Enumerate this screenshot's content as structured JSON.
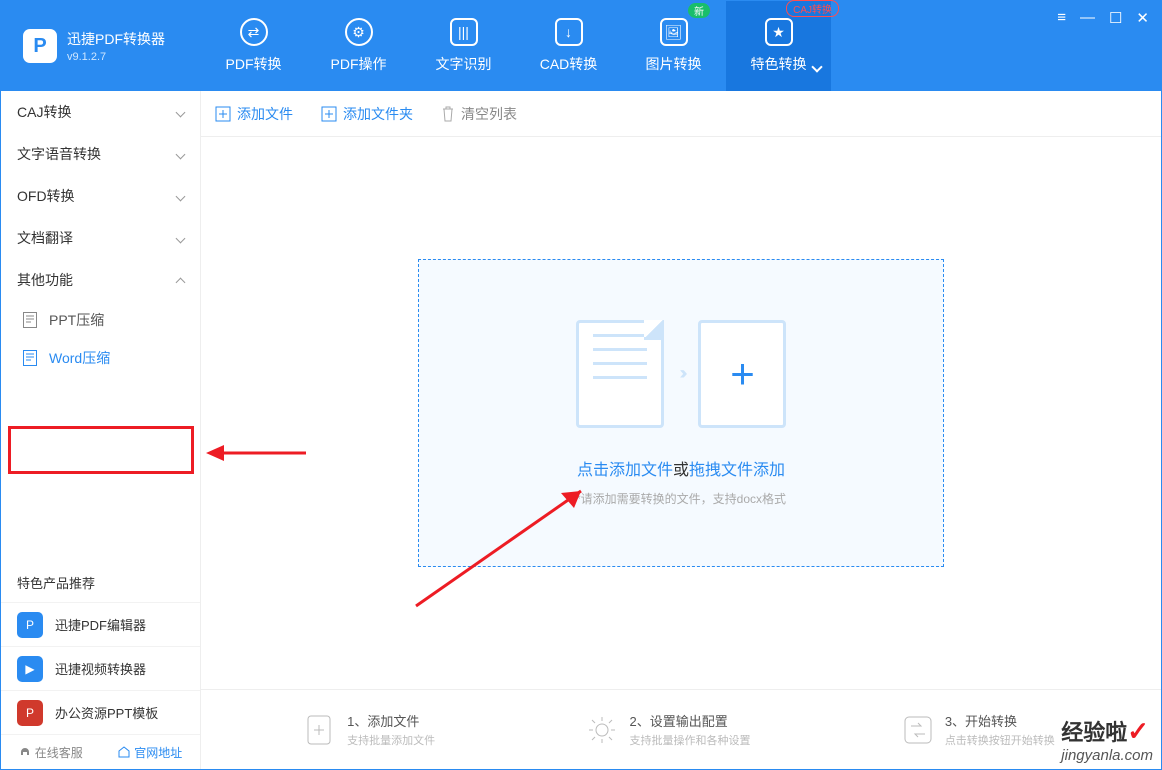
{
  "app": {
    "name": "迅捷PDF转换器",
    "version": "v9.1.2.7"
  },
  "nav": [
    {
      "label": "PDF转换"
    },
    {
      "label": "PDF操作"
    },
    {
      "label": "文字识别"
    },
    {
      "label": "CAD转换"
    },
    {
      "label": "图片转换",
      "badge": "新"
    },
    {
      "label": "特色转换",
      "badge": "CAJ转换"
    }
  ],
  "sidebar": {
    "cats": [
      {
        "label": "CAJ转换"
      },
      {
        "label": "文字语音转换"
      },
      {
        "label": "OFD转换"
      },
      {
        "label": "文档翻译"
      },
      {
        "label": "其他功能"
      }
    ],
    "subs": [
      {
        "label": "PPT压缩"
      },
      {
        "label": "Word压缩"
      }
    ],
    "promo_title": "特色产品推荐",
    "promos": [
      {
        "label": "迅捷PDF编辑器",
        "color": "#2a8bf1"
      },
      {
        "label": "迅捷视频转换器",
        "color": "#2a8bf1"
      },
      {
        "label": "办公资源PPT模板",
        "color": "#d0392c"
      }
    ],
    "footer": {
      "service": "在线客服",
      "site": "官网地址"
    }
  },
  "toolbar": {
    "add_file": "添加文件",
    "add_folder": "添加文件夹",
    "clear": "清空列表"
  },
  "dropzone": {
    "click": "点击添加文件",
    "or": "或",
    "drag": "拖拽文件添加",
    "hint": "*请添加需要转换的文件，支持docx格式"
  },
  "steps": [
    {
      "t1": "1、添加文件",
      "t2": "支持批量添加文件"
    },
    {
      "t1": "2、设置输出配置",
      "t2": "支持批量操作和各种设置"
    },
    {
      "t1": "3、开始转换",
      "t2": "点击转换按钮开始转换"
    }
  ],
  "watermark": {
    "big": "经验啦",
    "small": "jingyanla.com"
  }
}
